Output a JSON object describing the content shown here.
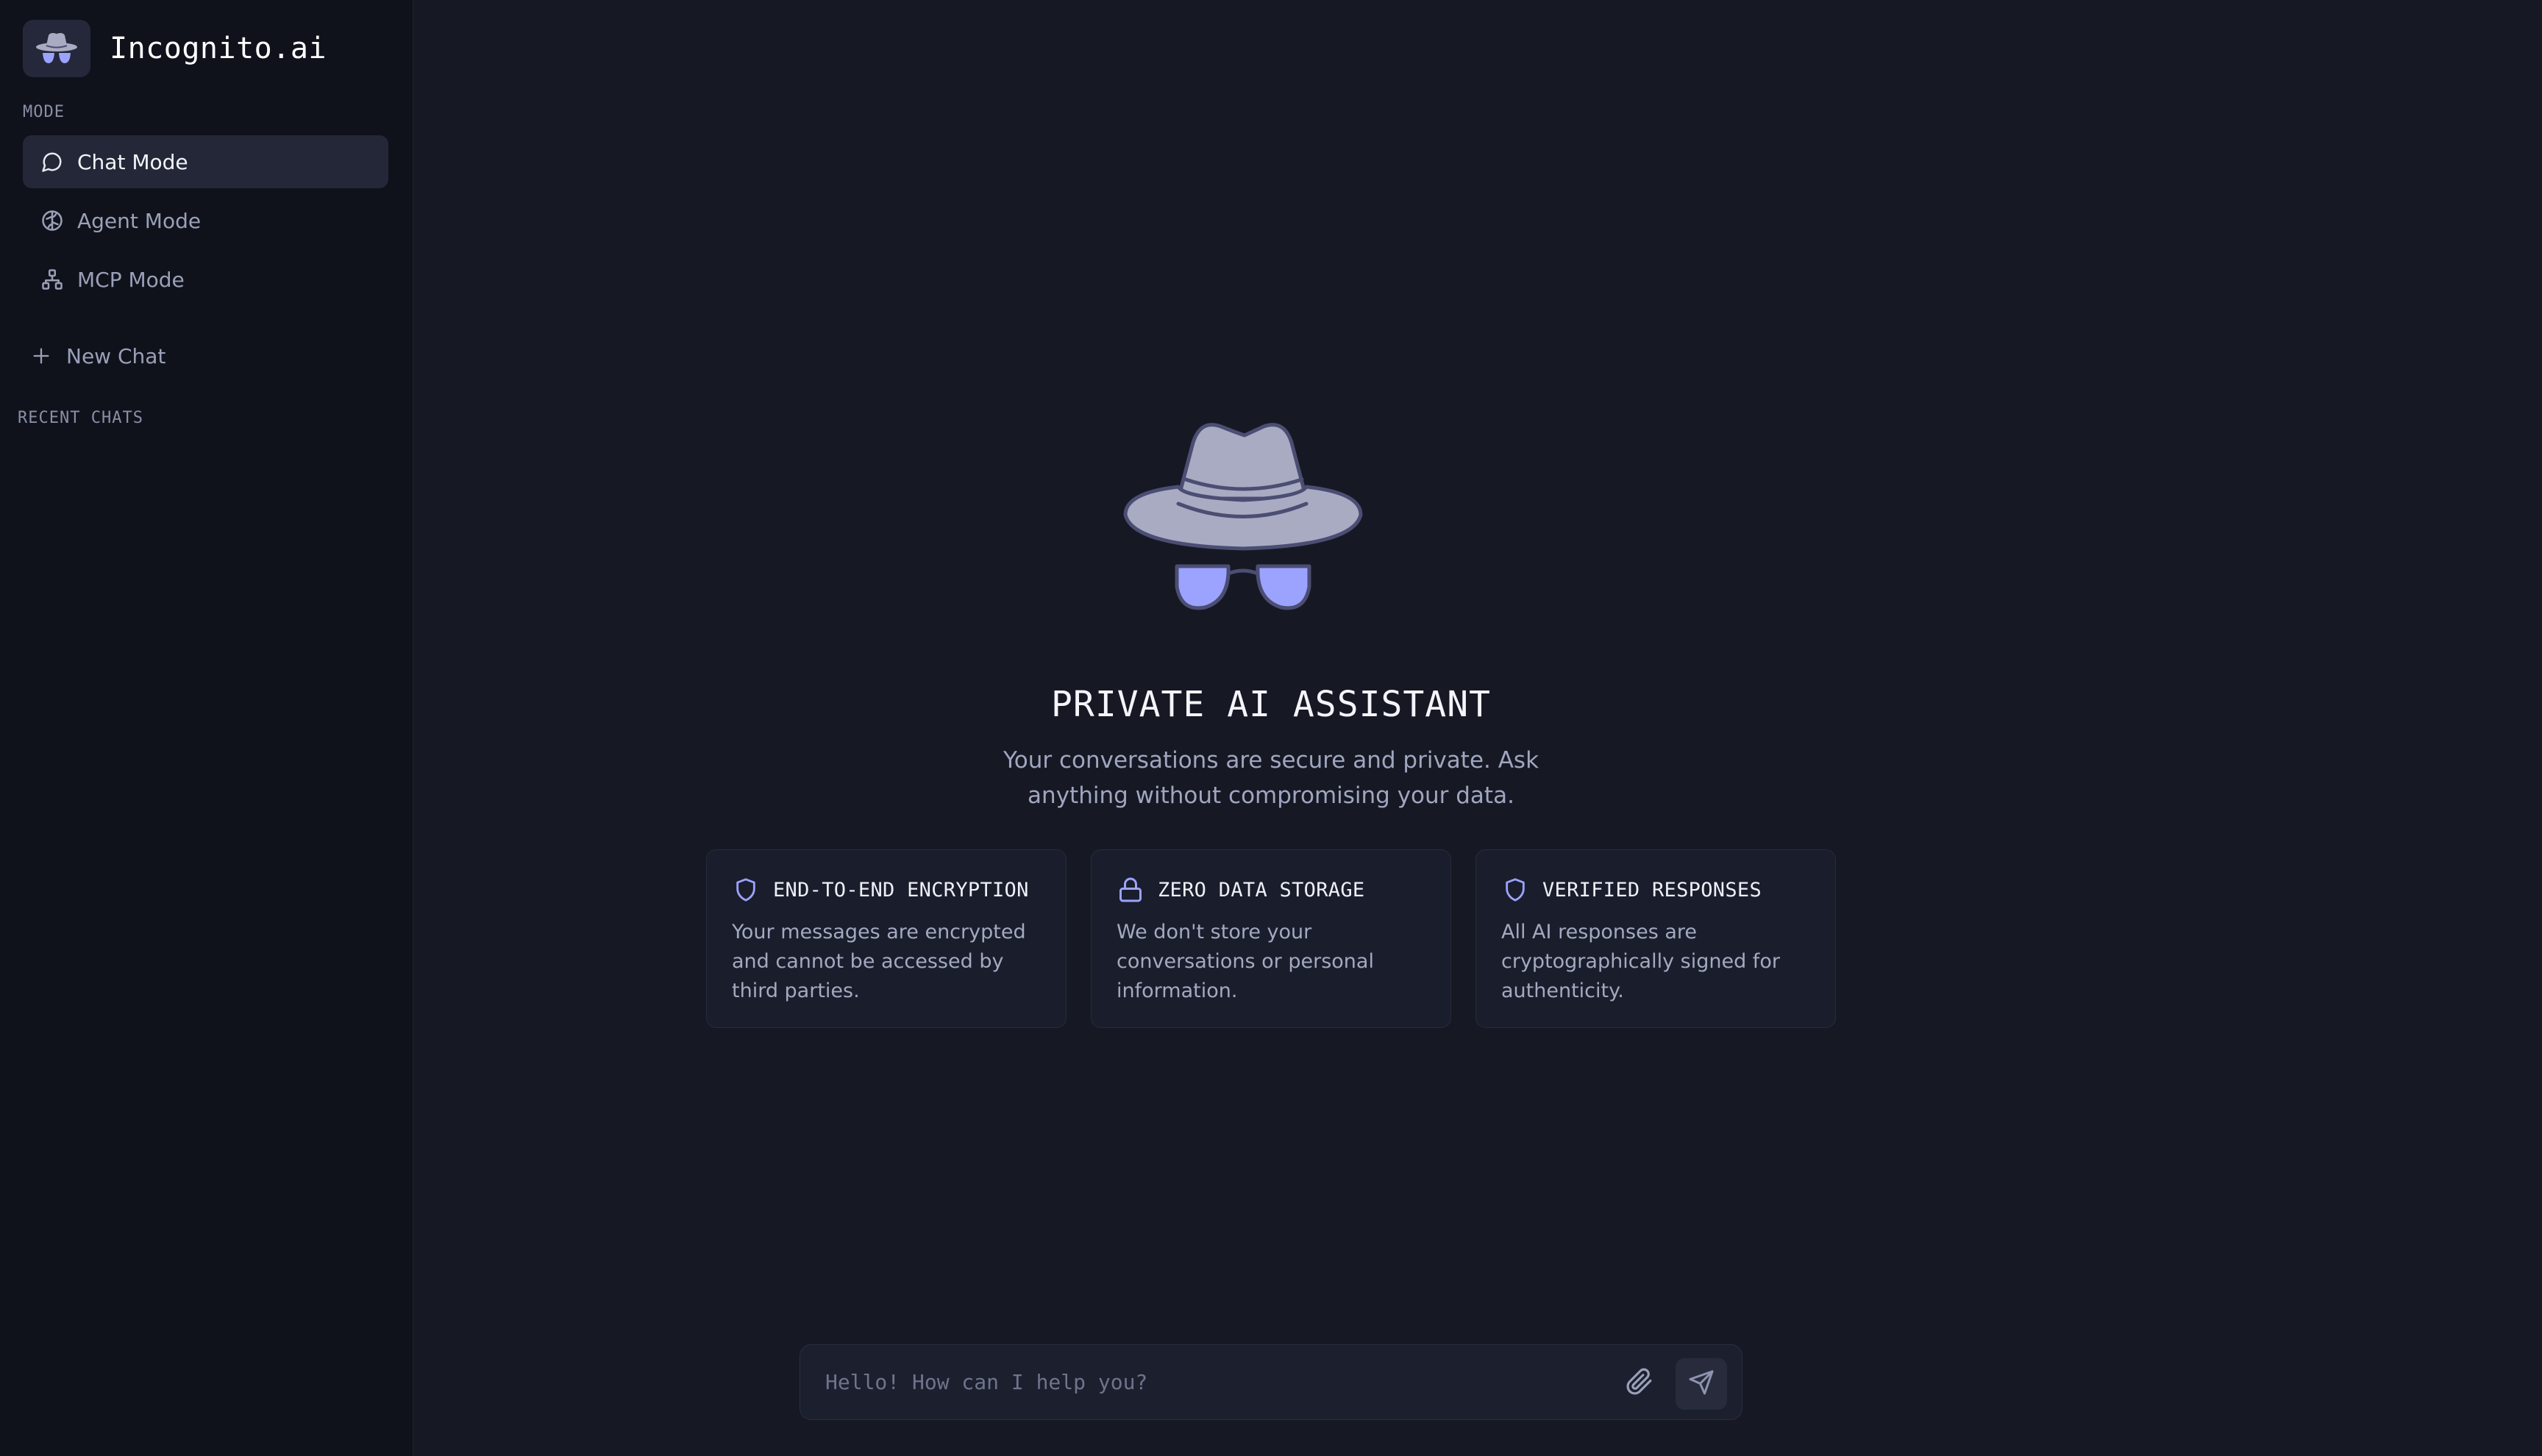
{
  "brand": {
    "title": "Incognito.ai",
    "logo_icon": "incognito-hat-glasses-icon"
  },
  "sidebar": {
    "mode_label": "MODE",
    "modes": [
      {
        "label": "Chat Mode",
        "icon": "chat-bubble-icon",
        "active": true
      },
      {
        "label": "Agent Mode",
        "icon": "brain-icon",
        "active": false
      },
      {
        "label": "MCP Mode",
        "icon": "network-icon",
        "active": false
      }
    ],
    "new_chat_label": "New Chat",
    "new_chat_icon": "plus-icon",
    "recent_label": "RECENT CHATS"
  },
  "hero": {
    "title": "PRIVATE AI ASSISTANT",
    "subtitle": "Your conversations are secure and private. Ask anything without compromising your data."
  },
  "features": [
    {
      "title": "END-TO-END ENCRYPTION",
      "description": "Your messages are encrypted and cannot be accessed by third parties.",
      "icon": "shield-icon"
    },
    {
      "title": "ZERO DATA STORAGE",
      "description": "We don't store your conversations or personal information.",
      "icon": "lock-icon"
    },
    {
      "title": "VERIFIED RESPONSES",
      "description": "All AI responses are cryptographically signed for authenticity.",
      "icon": "shield-icon"
    }
  ],
  "composer": {
    "placeholder": "Hello! How can I help you?",
    "value": "",
    "attach_icon": "paperclip-icon",
    "send_icon": "send-icon"
  },
  "colors": {
    "background": "#161824",
    "sidebar": "#10121b",
    "accent": "#9ba3ff",
    "hat": "#a9abc3",
    "outline": "#4b4e72"
  }
}
